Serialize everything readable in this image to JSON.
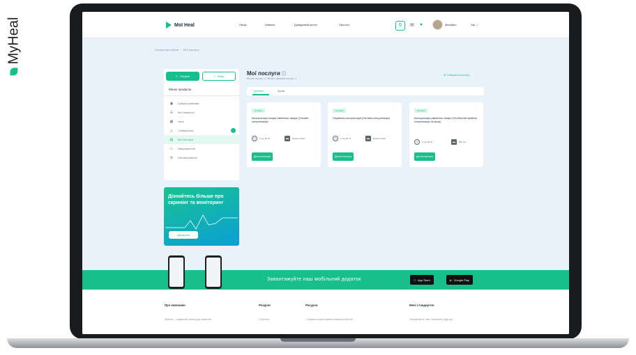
{
  "brand": {
    "vertical_logo_text": "MyHeal",
    "accent": "#16bf8c"
  },
  "header": {
    "logo": "Мої Heal",
    "nav": [
      "Лікарі",
      "Новини",
      "Довідковий центр",
      "Прогноз"
    ],
    "user_name": "Михайло",
    "lang": "Укр"
  },
  "breadcrumb": "Особистий кабінет → Мої послуги",
  "sidebar": {
    "roles": {
      "patient": "Пацієнт",
      "doctor": "Лікар"
    },
    "title": "Меню профілю",
    "items": [
      {
        "label": "Графік прийомів",
        "icon": "calendar-icon"
      },
      {
        "label": "Мої пацієнти",
        "icon": "list-icon"
      },
      {
        "label": "Чати",
        "icon": "chat-icon"
      },
      {
        "label": "Сповіщення",
        "icon": "bell-icon"
      },
      {
        "label": "Мої послуги",
        "icon": "services-icon"
      },
      {
        "label": "Направлення",
        "icon": "document-icon"
      },
      {
        "label": "Налаштування",
        "icon": "gear-icon"
      }
    ]
  },
  "promo": {
    "text": "Дізнайтесь більше про скринінг та моніторинг",
    "button": "Дізнатися"
  },
  "main": {
    "title": "Мої послуги",
    "subtitle": "Всього послуг: 3 • Всього архівних послуг: 2",
    "create_label": "Створити послугу",
    "tabs": [
      "Активні",
      "Архів"
    ],
    "cards": [
      {
        "badge": "Активна",
        "title": "Консультація лікаря сімейного лікаря (Онлайн-консультація)",
        "duration": "1 год 30 хв",
        "price": "Безкоштовно",
        "button": "Деталі послуги"
      },
      {
        "badge": "Активна",
        "title": "Первинна консультація (Онлайн-консультація)",
        "duration": "1 год 30 хв",
        "price": "Безкоштовно",
        "button": "Деталі послуги"
      },
      {
        "badge": "Активна",
        "title": "Консультація сімейного лікаря (Особистий прийом/консультація на місці)",
        "duration": "1 год 30 хв",
        "price": "300 грн",
        "button": "Деталі послуги"
      }
    ]
  },
  "banner": {
    "text": "Завантажуйте наш мобільний додаток",
    "appstore": "App Store",
    "googleplay": "Google Play"
  },
  "footer": {
    "columns": [
      {
        "heading": "Про компанію",
        "link": "MyHeal — медичний сервіс для пацієнтів"
      },
      {
        "heading": "Розділи",
        "link": "• Прогноз"
      },
      {
        "heading": "Ресурси",
        "link": "• Правила користування сервісом MyHeal"
      },
      {
        "heading": "Мені стандартно",
        "link": "Телефонуйте нам і запитуйте будь-що"
      }
    ]
  }
}
